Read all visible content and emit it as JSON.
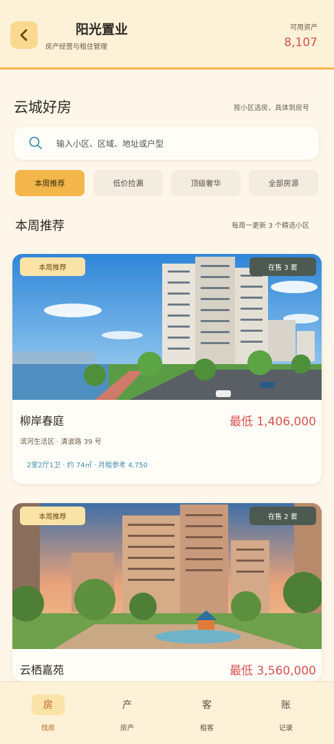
{
  "header": {
    "title": "阳光置业",
    "subtitle": "房产经营与租住管理",
    "asset_label": "可用资产",
    "asset_value": "8,107"
  },
  "page": {
    "title": "云城好房",
    "hint": "按小区选房，具体到房号"
  },
  "search": {
    "placeholder": "输入小区、区域、地址或户型"
  },
  "filters": [
    {
      "label": "本周推荐",
      "active": true
    },
    {
      "label": "低价捡漏",
      "active": false
    },
    {
      "label": "顶级奢华",
      "active": false
    },
    {
      "label": "全部房源",
      "active": false
    }
  ],
  "section": {
    "title": "本周推荐",
    "hint": "每周一更新 3 个精选小区"
  },
  "listings": [
    {
      "tag": "本周推荐",
      "sale": "在售 3 套",
      "name": "柳岸春庭",
      "price": "最低 1,406,000",
      "address": "滨河生活区 · 清波路 39 号",
      "meta": "2室2厅1卫 · 约 74㎡ · 月租参考 4,750"
    },
    {
      "tag": "本周推荐",
      "sale": "在售 2 套",
      "name": "云栖嘉苑",
      "price": "最低 3,560,000"
    }
  ],
  "nav": [
    {
      "icon": "房",
      "label": "找房",
      "active": true
    },
    {
      "icon": "产",
      "label": "房产",
      "active": false
    },
    {
      "icon": "客",
      "label": "租客",
      "active": false
    },
    {
      "icon": "账",
      "label": "记录",
      "active": false
    }
  ],
  "colors": {
    "accent": "#f2b64a",
    "price": "#d9534f",
    "background": "#fdf6e9"
  }
}
